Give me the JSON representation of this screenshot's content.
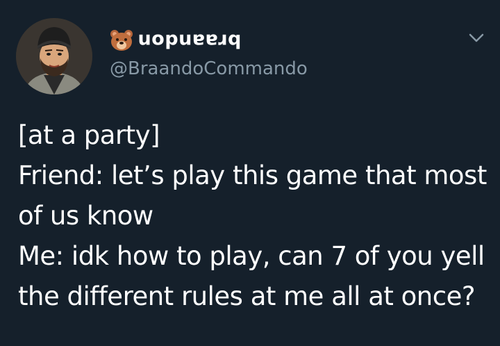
{
  "tweet": {
    "display_name": "braandon",
    "name_emoji": "bear-face-icon",
    "handle": "@BraandoCommando",
    "text": "[at a party]\nFriend: let’s play this game that most of us know\nMe: idk how to play, can 7 of you yell the different rules at me all at once?"
  },
  "icons": {
    "avatar": "cartoon-man-beanie-avatar",
    "menu": "chevron-down-icon"
  },
  "colors": {
    "background": "#15202b",
    "text": "#ffffff",
    "secondary_text": "#8899a6"
  }
}
